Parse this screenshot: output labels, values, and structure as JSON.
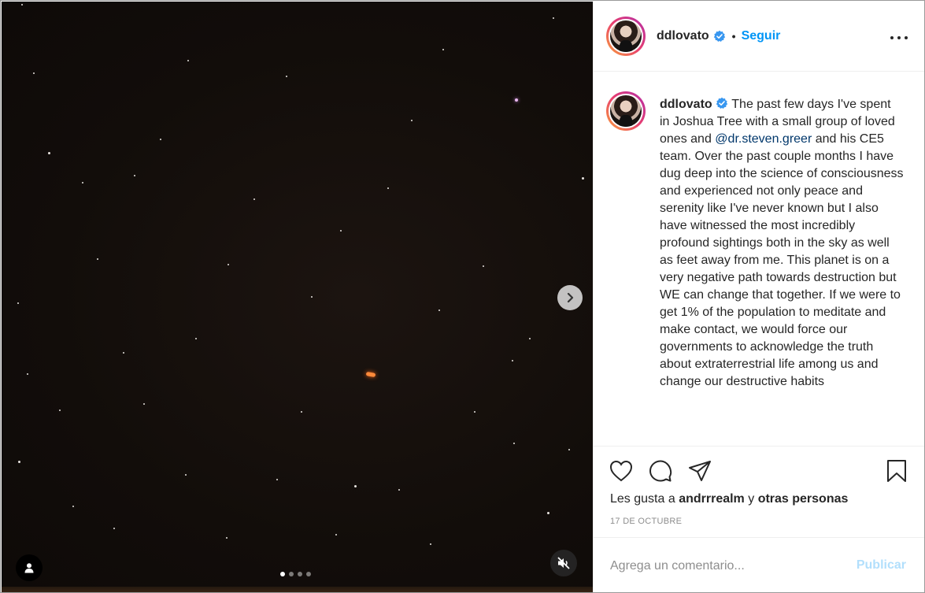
{
  "post": {
    "username": "ddlovato",
    "separator": "•",
    "follow_label": "Seguir",
    "caption": {
      "username": "ddlovato",
      "text_before_mention": "The past few days I've spent in Joshua Tree with a small group of loved ones and",
      "mention": "@dr.steven.greer",
      "text_after_mention": "and his CE5 team. Over the past couple months I have dug deep into the science of consciousness and experienced not only peace and serenity like I've never known but I also have witnessed the most incredibly profound sightings both in the sky as well as feet away from me. This planet is on a very negative path towards destruction but WE can change that together. If we were to get 1% of the population to meditate and make contact, we would force our governments to acknowledge the truth about extraterrestrial life among us and change our destructive habits"
    },
    "likes": {
      "prefix": "Les gusta a",
      "user": "andrrrealm",
      "connector": "y",
      "others": "otras personas"
    },
    "date": "17 DE OCTUBRE",
    "comment": {
      "placeholder": "Agrega un comentario...",
      "publish_label": "Publicar"
    }
  },
  "media": {
    "carousel_total": 4,
    "carousel_active": 1
  },
  "icons": {
    "next": "chevron-right-icon",
    "user_tag": "user-icon",
    "mute": "speaker-muted-icon",
    "like": "heart-icon",
    "comment": "comment-icon",
    "share": "paper-plane-icon",
    "save": "bookmark-icon",
    "more": "ellipsis-icon",
    "verified": "verified-badge-icon"
  },
  "colors": {
    "accent": "#0095f6",
    "publish_disabled": "#b2dffc",
    "text": "#262626",
    "muted": "#8e8e8e",
    "mention": "#00376b"
  }
}
